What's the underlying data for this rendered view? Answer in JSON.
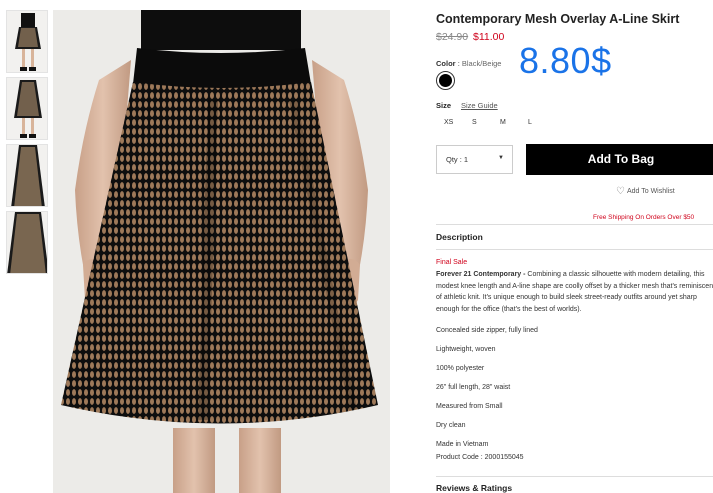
{
  "product": {
    "title": "Contemporary Mesh Overlay A-Line Skirt",
    "price_original": "$24.90",
    "price_sale": "$11.00",
    "overlay_price": "8.80$",
    "color_label": "Color",
    "color_value": "Black/Beige",
    "size_label": "Size",
    "size_guide": "Size Guide",
    "sizes": [
      "XS",
      "S",
      "M",
      "L"
    ],
    "quantity": "Qty : 1",
    "add_to_bag": "Add To Bag",
    "wishlist": "Add To Wishlist",
    "shipping": "Free Shipping On Orders Over $50"
  },
  "description": {
    "heading": "Description",
    "final_sale": "Final Sale",
    "brand": "Forever 21 Contemporary -",
    "text": " Combining a classic silhouette with modern detailing, this modest knee length and A-line shape are coolly offset by a thicker mesh that's reminiscent of athletic knit. It's unique enough to build sleek street-ready outfits around yet sharp enough for the office (that's the best of worlds).",
    "details": [
      "Concealed side zipper, fully lined",
      "Lightweight, woven",
      "100% polyester",
      "26\" full length, 28\" waist",
      "Measured from Small",
      "Dry clean",
      "Made in Vietnam",
      "Product Code : 2000155045"
    ]
  },
  "reviews": {
    "heading": "Reviews & Ratings"
  },
  "colors": {
    "sale_red": "#d0021b",
    "overlay_blue": "#1a73e8",
    "button_black": "#000000"
  }
}
